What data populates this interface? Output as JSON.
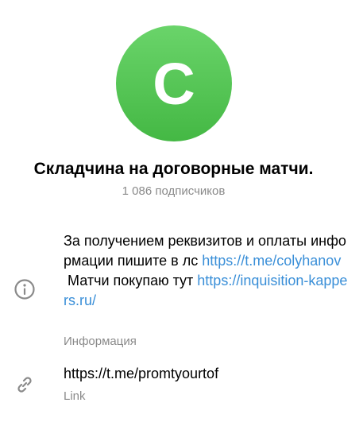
{
  "channel": {
    "avatar_letter": "C",
    "avatar_color": "#4cbf4c",
    "title": "Складчина на договорные матчи.",
    "subscribers": "1 086 подписчиков"
  },
  "info": {
    "line1_text": "За получением реквизитов и оплаты информации пишите в лс ",
    "line1_link": "https://t.me/colyhanov",
    "line2_text": "\n Матчи покупаю тут ",
    "line2_link": "https://inquisition-kappers.ru/",
    "caption": "Информация",
    "icon": "info-icon"
  },
  "link": {
    "value": "https://t.me/promtyourtof",
    "caption": "Link",
    "icon": "link-icon"
  },
  "colors": {
    "link": "#3a8fd8",
    "secondary": "#8a8a8a"
  }
}
